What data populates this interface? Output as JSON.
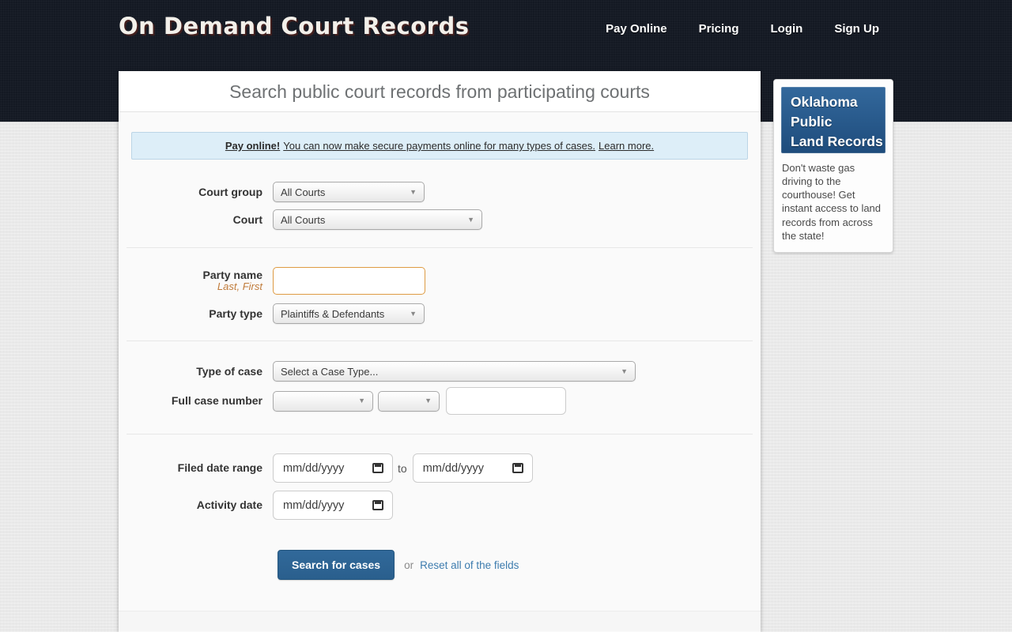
{
  "header": {
    "logo": "On Demand Court Records",
    "nav": [
      {
        "label": "Pay Online"
      },
      {
        "label": "Pricing"
      },
      {
        "label": "Login"
      },
      {
        "label": "Sign Up"
      }
    ]
  },
  "main": {
    "title": "Search public court records from participating courts",
    "banner": {
      "bold": "Pay online!",
      "text": "You can now make secure payments online for many types of cases.",
      "link": "Learn more."
    },
    "form": {
      "court_group": {
        "label": "Court group",
        "value": "All Courts"
      },
      "court": {
        "label": "Court",
        "value": "All Courts"
      },
      "party_name": {
        "label": "Party name",
        "hint": "Last, First",
        "value": ""
      },
      "party_type": {
        "label": "Party type",
        "value": "Plaintiffs & Defendants"
      },
      "case_type": {
        "label": "Type of case",
        "value": "Select a Case Type..."
      },
      "case_number": {
        "label": "Full case number",
        "select1_value": "",
        "select2_value": "",
        "input_value": ""
      },
      "filed_date": {
        "label": "Filed date range",
        "from_placeholder": "mm/dd/yyyy",
        "to_word": "to",
        "to_placeholder": "mm/dd/yyyy"
      },
      "activity_date": {
        "label": "Activity date",
        "placeholder": "mm/dd/yyyy"
      },
      "search_button": "Search for cases",
      "or_word": "or",
      "reset_link": "Reset all of the fields"
    }
  },
  "sidebar": {
    "ad_title_lines": [
      "Oklahoma",
      "Public",
      "Land Records"
    ],
    "ad_text": "Don't waste gas driving to the courthouse! Get instant access to land records from across the state!"
  },
  "colors": {
    "header_bg": "#141923",
    "button_blue": "#2e6594",
    "link_blue": "#3d7cae",
    "banner_bg": "#ddeef8",
    "ad_box_blue": "#2a5b8c",
    "party_input_border": "#de9b43"
  }
}
